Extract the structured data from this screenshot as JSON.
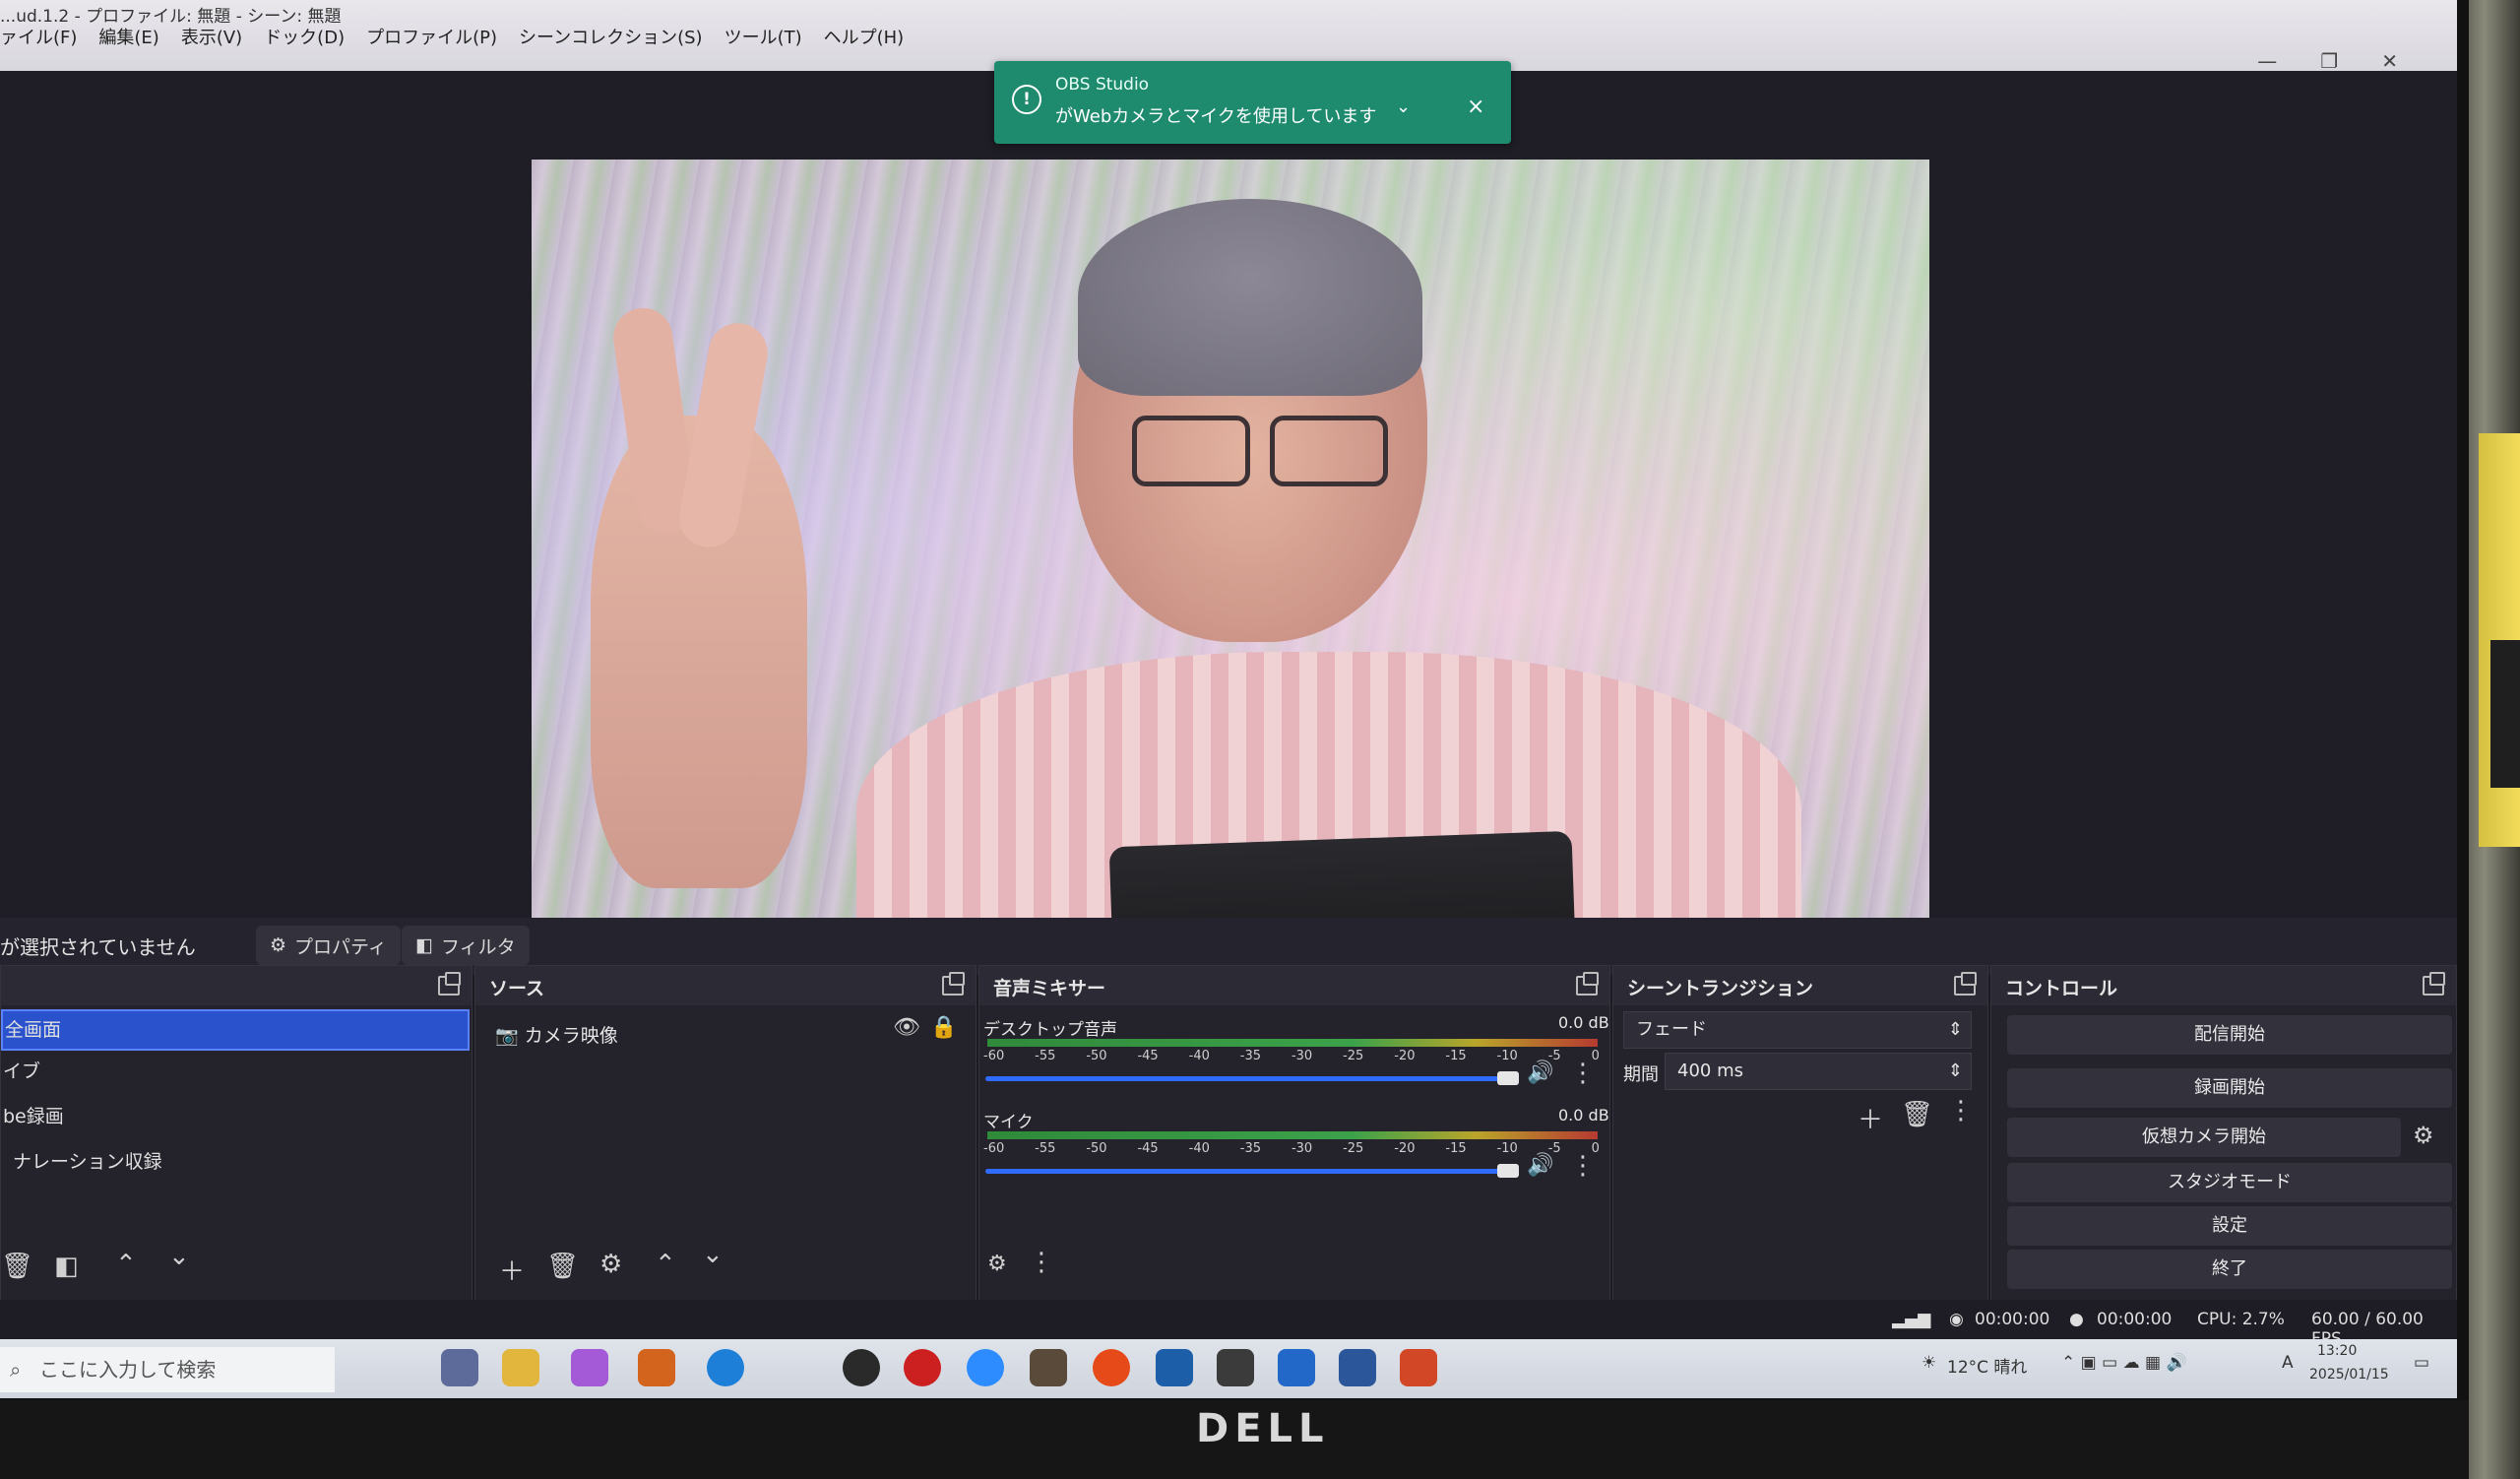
{
  "window": {
    "title": "...ud.1.2 - プロファイル: 無題 - シーン: 無題",
    "controls": [
      "—",
      "❐",
      "✕"
    ]
  },
  "menu": [
    "ァイル(F)",
    "編集(E)",
    "表示(V)",
    "ドック(D)",
    "プロファイル(P)",
    "シーンコレクション(S)",
    "ツール(T)",
    "ヘルプ(H)"
  ],
  "notification": {
    "app": "OBS Studio",
    "message": "がWebカメラとマイクを使用しています"
  },
  "context": {
    "no_selection": "が選択されていません",
    "properties": "プロパティ",
    "filters": "フィルタ"
  },
  "scenes": {
    "items": [
      "全画面",
      "イブ",
      "be録画",
      "ナレーション収録"
    ]
  },
  "sources": {
    "title": "ソース",
    "items": [
      "カメラ映像"
    ]
  },
  "mixer": {
    "title": "音声ミキサー",
    "channels": [
      {
        "name": "デスクトップ音声",
        "db": "0.0 dB"
      },
      {
        "name": "マイク",
        "db": "0.0 dB"
      }
    ],
    "ticks": [
      "-60",
      "-55",
      "-50",
      "-45",
      "-40",
      "-35",
      "-30",
      "-25",
      "-20",
      "-15",
      "-10",
      "-5",
      "0"
    ]
  },
  "transitions": {
    "title": "シーントランジション",
    "type": "フェード",
    "duration_label": "期間",
    "duration": "400 ms"
  },
  "controls": {
    "title": "コントロール",
    "buttons": [
      "配信開始",
      "録画開始",
      "仮想カメラ開始",
      "スタジオモード",
      "設定",
      "終了"
    ]
  },
  "status": {
    "stream_time": "00:00:00",
    "record_time": "00:00:00",
    "cpu": "CPU: 2.7%",
    "fps": "60.00 / 60.00 FPS"
  },
  "taskbar": {
    "search_placeholder": "ここに入力して検索",
    "weather": "12°C 晴れ",
    "ime": "A",
    "time": "13:20",
    "date": "2025/01/15"
  },
  "brand": "DELL"
}
